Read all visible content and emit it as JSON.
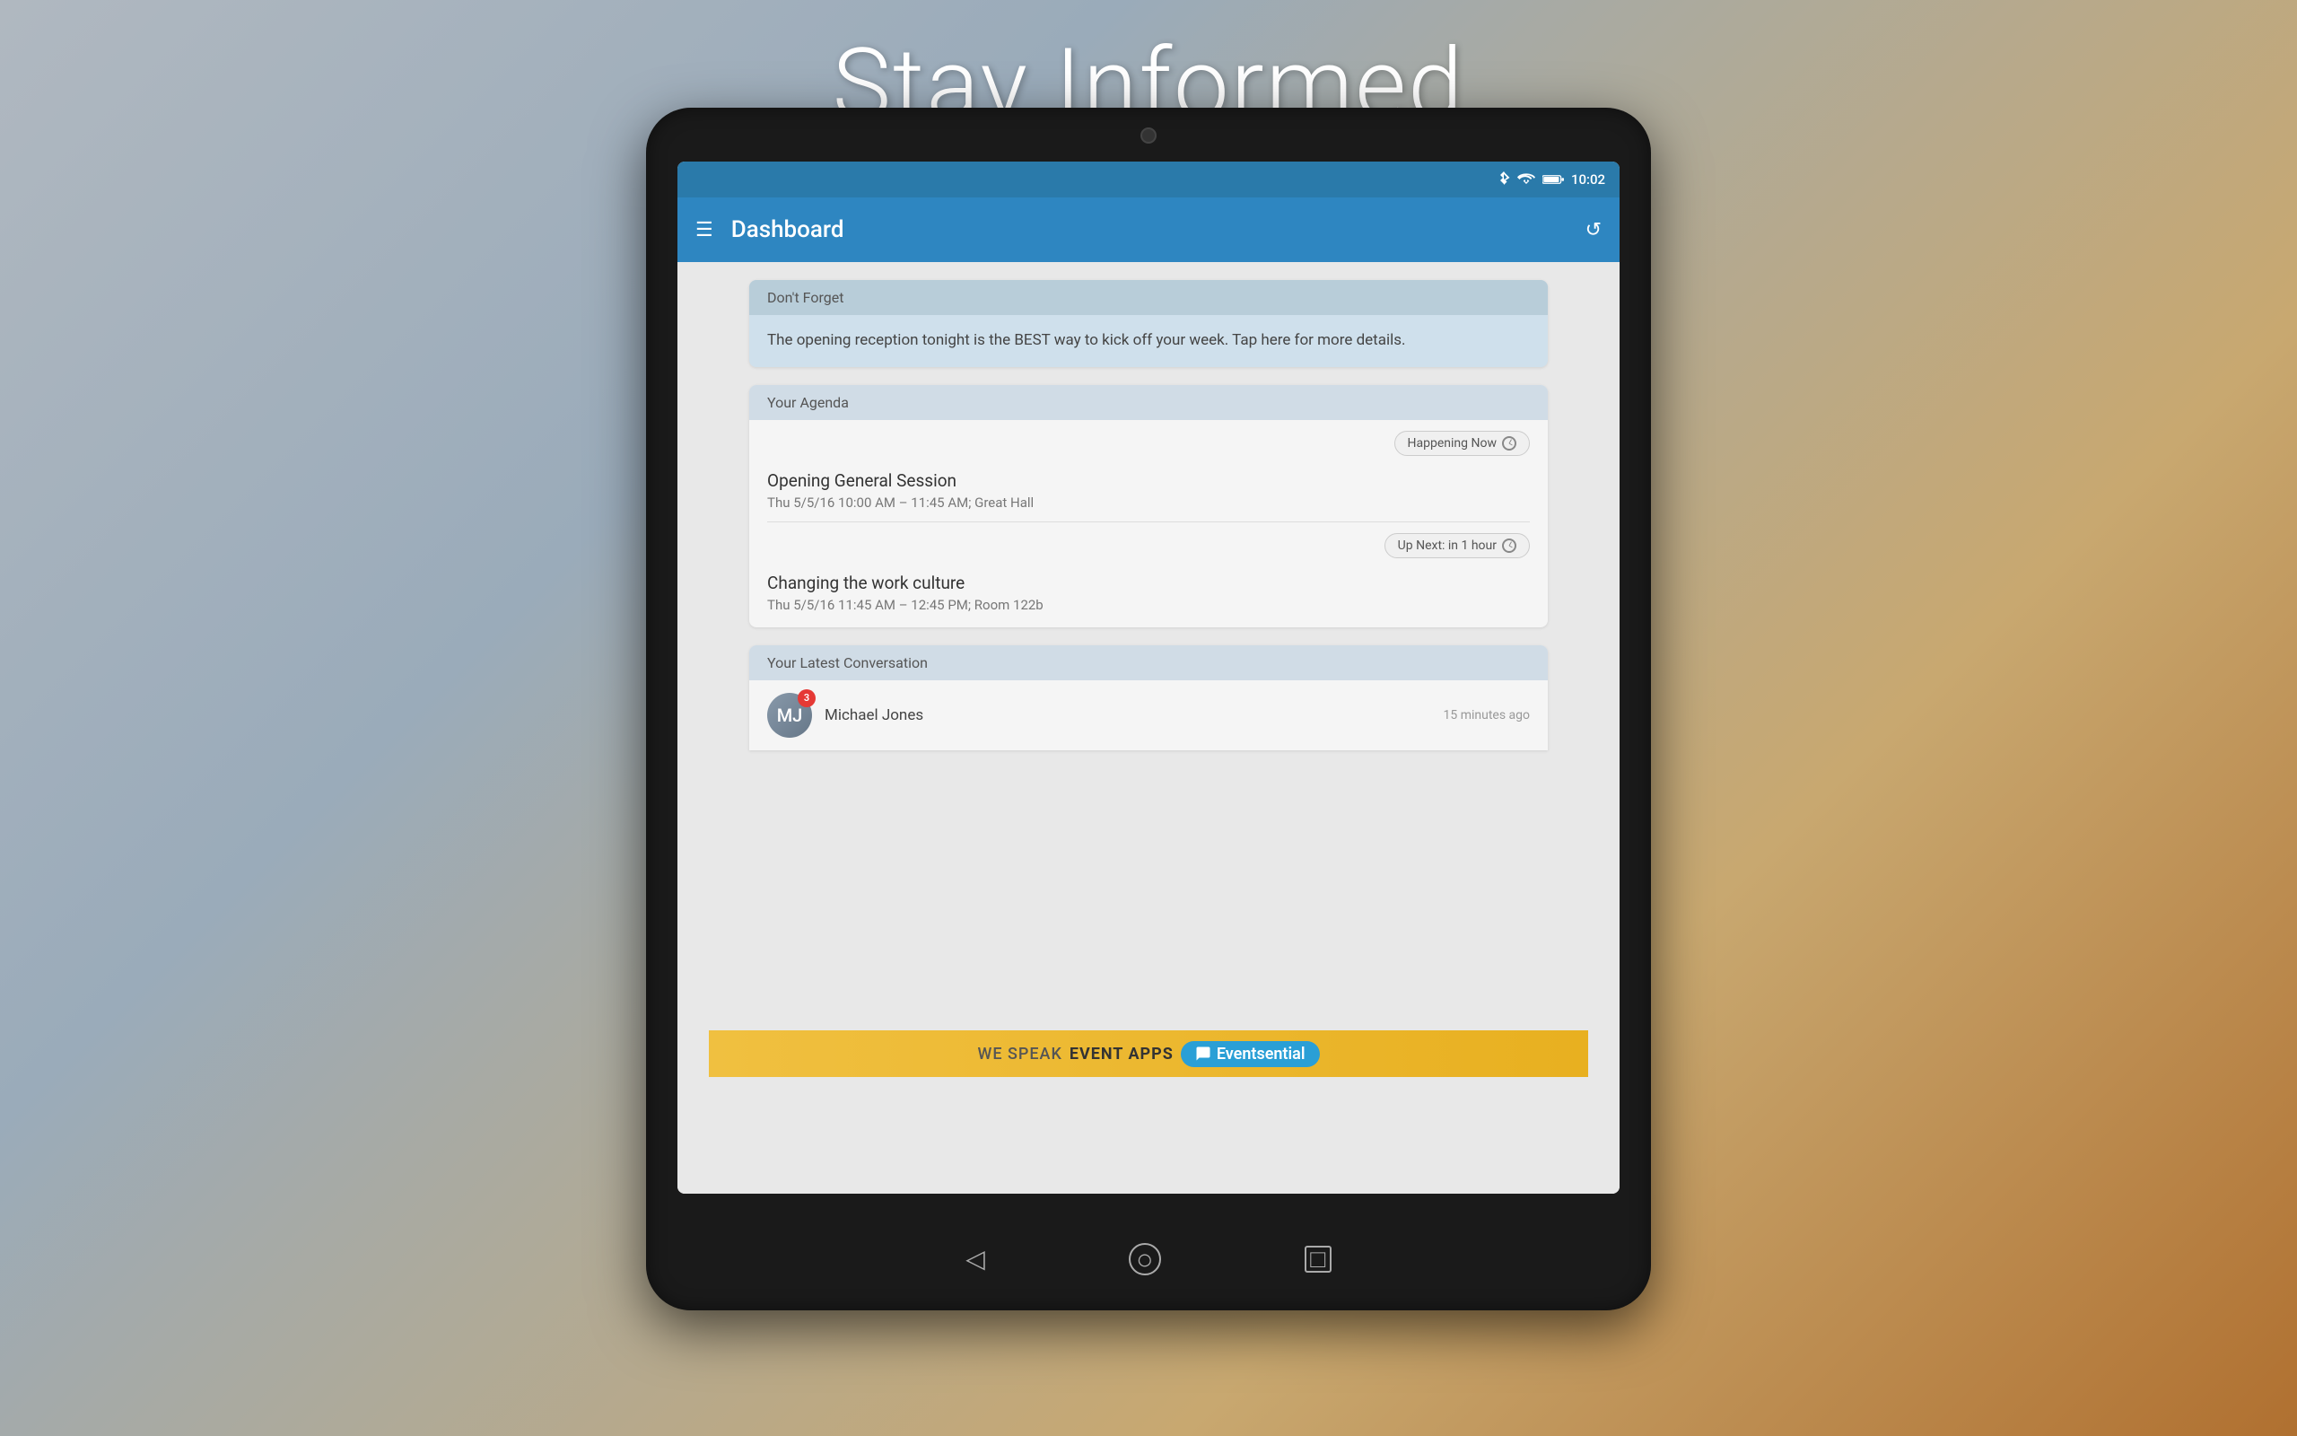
{
  "page": {
    "title": "Stay Informed",
    "background_gradient": "linear-gradient(135deg, #b0b8c0, #c8a870, #b07030)"
  },
  "status_bar": {
    "time": "10:02",
    "icons": [
      "bluetooth",
      "wifi",
      "battery"
    ]
  },
  "app_bar": {
    "title": "Dashboard",
    "hamburger_label": "☰",
    "refresh_label": "↺"
  },
  "dont_forget_card": {
    "header": "Don't Forget",
    "body": "The opening reception tonight is the BEST way to kick off your week. Tap here for more details."
  },
  "agenda_card": {
    "header": "Your Agenda",
    "happening_now_label": "Happening Now",
    "up_next_label": "Up Next: in 1 hour",
    "sessions": [
      {
        "title": "Opening General Session",
        "details": "Thu 5/5/16 10:00 AM – 11:45 AM; Great Hall"
      },
      {
        "title": "Changing the work culture",
        "details": "Thu 5/5/16 11:45 AM – 12:45 PM; Room 122b"
      }
    ]
  },
  "conversation_card": {
    "header": "Your Latest Conversation",
    "items": [
      {
        "name": "Michael Jones",
        "time": "15 minutes ago",
        "badge": "3",
        "avatar_initials": "MJ"
      }
    ]
  },
  "banner": {
    "prefix": "WE SPEAK",
    "highlight": "EVENT APPS",
    "brand": "Eventsential"
  },
  "nav_buttons": {
    "back": "◁",
    "home": "○",
    "recent": "□"
  }
}
